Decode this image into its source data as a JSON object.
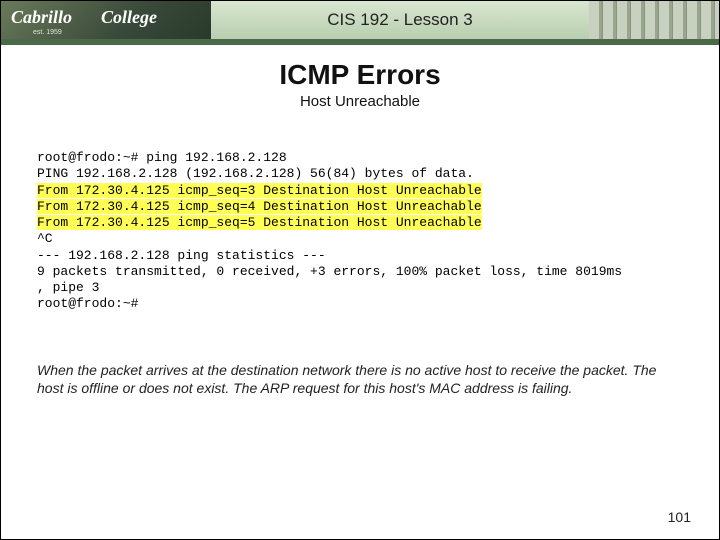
{
  "header": {
    "logo_text": "Cabrillo College",
    "logo_sub": "est. 1959",
    "lesson": "CIS 192 - Lesson 3"
  },
  "title": "ICMP Errors",
  "subtitle": "Host Unreachable",
  "terminal": {
    "line1": "root@frodo:~# ping 192.168.2.128",
    "line2": "PING 192.168.2.128 (192.168.2.128) 56(84) bytes of data.",
    "line3": "From 172.30.4.125 icmp_seq=3 Destination Host Unreachable",
    "line4": "From 172.30.4.125 icmp_seq=4 Destination Host Unreachable",
    "line5": "From 172.30.4.125 icmp_seq=5 Destination Host Unreachable",
    "line6": "^C",
    "line7": "--- 192.168.2.128 ping statistics ---",
    "line8": "9 packets transmitted, 0 received, +3 errors, 100% packet loss, time 8019ms",
    "line9": ", pipe 3",
    "line10": "root@frodo:~#"
  },
  "caption": "When the packet arrives at the destination network there is no active host to receive the packet.  The host is offline or does not exist.  The ARP request for this host's MAC address is failing.",
  "page_number": "101"
}
